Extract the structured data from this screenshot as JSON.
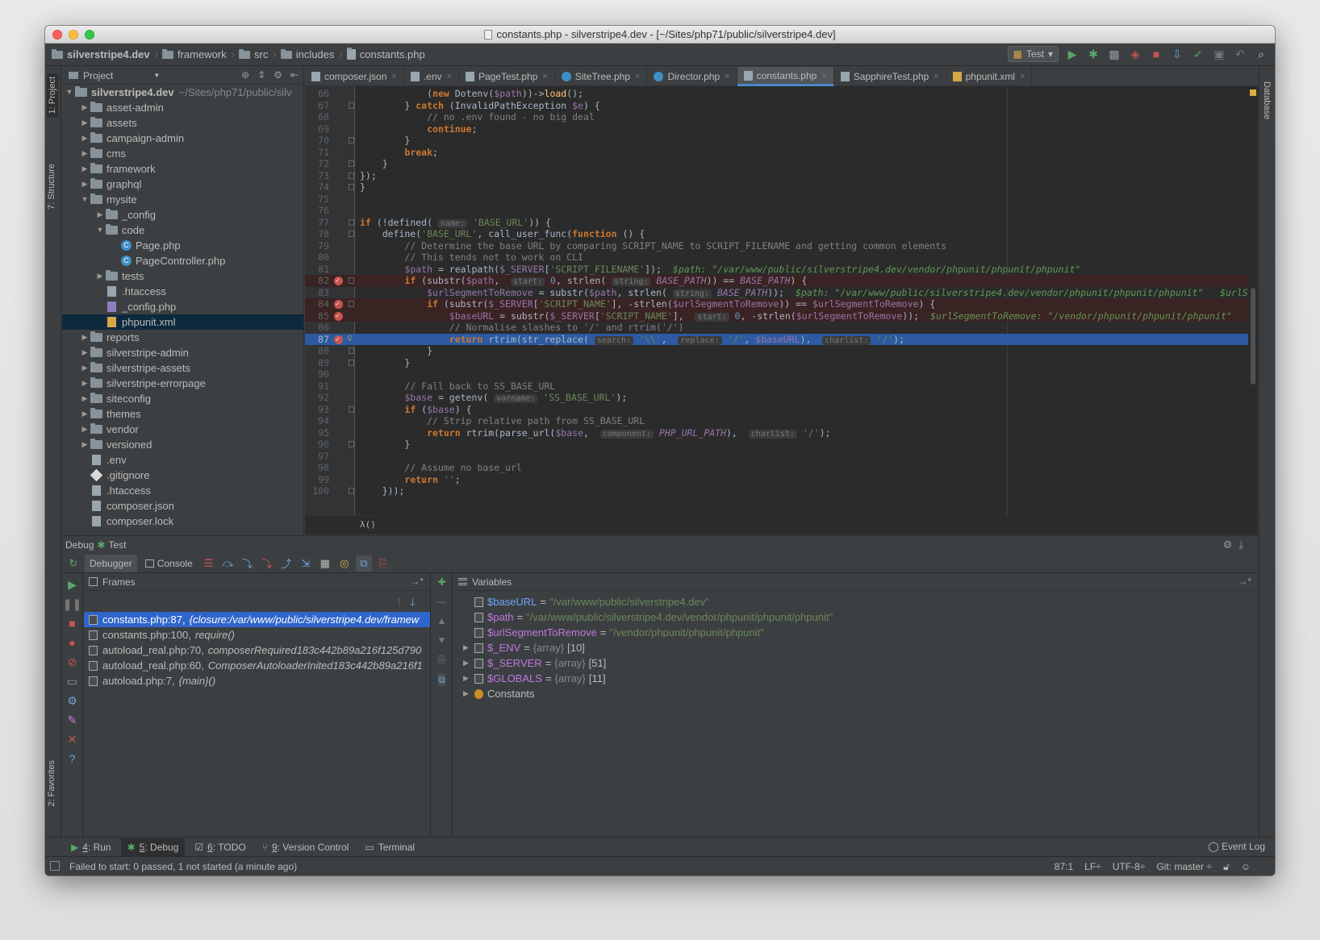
{
  "window": {
    "title": "constants.php - silverstripe4.dev - [~/Sites/php71/public/silverstripe4.dev]"
  },
  "breadcrumbs": [
    "silverstripe4.dev",
    "framework",
    "src",
    "includes",
    "constants.php"
  ],
  "run_config": {
    "name": "Test"
  },
  "left_strip": {
    "project_tab": "1: Project",
    "structure_tab": "7: Structure",
    "favorites_tab": "2: Favorites"
  },
  "right_strip": {
    "database_tab": "Database"
  },
  "project_panel": {
    "header": "Project",
    "root": {
      "name": "silverstripe4.dev",
      "path": "~/Sites/php71/public/silv"
    },
    "items": [
      {
        "label": "asset-admin",
        "kind": "folder",
        "indent": 1,
        "arrow": "▶"
      },
      {
        "label": "assets",
        "kind": "folder",
        "indent": 1,
        "arrow": "▶"
      },
      {
        "label": "campaign-admin",
        "kind": "folder",
        "indent": 1,
        "arrow": "▶"
      },
      {
        "label": "cms",
        "kind": "folder",
        "indent": 1,
        "arrow": "▶"
      },
      {
        "label": "framework",
        "kind": "folder",
        "indent": 1,
        "arrow": "▶"
      },
      {
        "label": "graphql",
        "kind": "folder",
        "indent": 1,
        "arrow": "▶"
      },
      {
        "label": "mysite",
        "kind": "folder",
        "indent": 1,
        "arrow": "▼"
      },
      {
        "label": "_config",
        "kind": "folder",
        "indent": 2,
        "arrow": "▶"
      },
      {
        "label": "code",
        "kind": "folder",
        "indent": 2,
        "arrow": "▼"
      },
      {
        "label": "Page.php",
        "kind": "class",
        "indent": 3,
        "arrow": ""
      },
      {
        "label": "PageController.php",
        "kind": "class",
        "indent": 3,
        "arrow": ""
      },
      {
        "label": "tests",
        "kind": "folder",
        "indent": 2,
        "arrow": "▶"
      },
      {
        "label": ".htaccess",
        "kind": "file",
        "indent": 2,
        "arrow": ""
      },
      {
        "label": "_config.php",
        "kind": "php",
        "indent": 2,
        "arrow": ""
      },
      {
        "label": "phpunit.xml",
        "kind": "xml",
        "indent": 2,
        "arrow": "",
        "selected": true
      },
      {
        "label": "reports",
        "kind": "folder",
        "indent": 1,
        "arrow": "▶"
      },
      {
        "label": "silverstripe-admin",
        "kind": "folder",
        "indent": 1,
        "arrow": "▶"
      },
      {
        "label": "silverstripe-assets",
        "kind": "folder",
        "indent": 1,
        "arrow": "▶"
      },
      {
        "label": "silverstripe-errorpage",
        "kind": "folder",
        "indent": 1,
        "arrow": "▶"
      },
      {
        "label": "siteconfig",
        "kind": "folder",
        "indent": 1,
        "arrow": "▶"
      },
      {
        "label": "themes",
        "kind": "folder",
        "indent": 1,
        "arrow": "▶"
      },
      {
        "label": "vendor",
        "kind": "folder",
        "indent": 1,
        "arrow": "▶"
      },
      {
        "label": "versioned",
        "kind": "folder",
        "indent": 1,
        "arrow": "▶"
      },
      {
        "label": ".env",
        "kind": "file",
        "indent": 1,
        "arrow": ""
      },
      {
        "label": ".gitignore",
        "kind": "git",
        "indent": 1,
        "arrow": ""
      },
      {
        "label": ".htaccess",
        "kind": "file",
        "indent": 1,
        "arrow": ""
      },
      {
        "label": "composer.json",
        "kind": "file",
        "indent": 1,
        "arrow": ""
      },
      {
        "label": "composer.lock",
        "kind": "file",
        "indent": 1,
        "arrow": ""
      }
    ]
  },
  "editor": {
    "tabs": [
      {
        "label": "composer.json",
        "icon": "file"
      },
      {
        "label": ".env",
        "icon": "file"
      },
      {
        "label": "PageTest.php",
        "icon": "file"
      },
      {
        "label": "SiteTree.php",
        "icon": "class"
      },
      {
        "label": "Director.php",
        "icon": "class"
      },
      {
        "label": "constants.php",
        "icon": "file",
        "active": true
      },
      {
        "label": "SapphireTest.php",
        "icon": "file"
      },
      {
        "label": "phpunit.xml",
        "icon": "xml"
      }
    ],
    "footer": "λ()",
    "lines": [
      {
        "n": "66",
        "html": "            (<span class=\"kw\">new</span> Dotenv(<span class=\"var\">$path</span>))-&gt;<span class=\"fn\">load</span>();"
      },
      {
        "n": "67",
        "html": "        } <span class=\"kw\">catch</span> (InvalidPathException <span class=\"var\">$e</span>) {"
      },
      {
        "n": "68",
        "html": "            <span class=\"cmt\">// no .env found - no big deal</span>"
      },
      {
        "n": "69",
        "html": "            <span class=\"kw\">continue</span>;"
      },
      {
        "n": "70",
        "html": "        }"
      },
      {
        "n": "71",
        "html": "        <span class=\"kw\">break</span>;"
      },
      {
        "n": "72",
        "html": "    }"
      },
      {
        "n": "73",
        "html": "});"
      },
      {
        "n": "74",
        "html": "}"
      },
      {
        "n": "75",
        "html": ""
      },
      {
        "n": "76",
        "html": ""
      },
      {
        "n": "77",
        "html": "<span class=\"kw\">if</span> (!defined( <span class=\"hint\">name:</span> <span class=\"str\">'BASE_URL'</span>)) {"
      },
      {
        "n": "78",
        "html": "    define(<span class=\"str\">'BASE_URL'</span>, call_user_func(<span class=\"kw\">function</span> () {"
      },
      {
        "n": "79",
        "html": "        <span class=\"cmt\">// Determine the base URL by comparing SCRIPT_NAME to SCRIPT_FILENAME and getting common elements</span>"
      },
      {
        "n": "80",
        "html": "        <span class=\"cmt\">// This tends not to work on CLI</span>"
      },
      {
        "n": "81",
        "html": "        <span class=\"var\">$path</span> = realpath(<span class=\"var\">$_SERVER</span>[<span class=\"str\">'SCRIPT_FILENAME'</span>]);<span class=\"inline-val\">$path: \"/var/www/public/silverstripe4.dev/vendor/phpunit/phpunit/phpunit\"</span>"
      },
      {
        "n": "82",
        "html": "        <span class=\"kw\">if</span> (substr(<span class=\"var\">$path</span>,  <span class=\"hint\">start:</span> <span class=\"num\">0</span>, strlen( <span class=\"hint\">string:</span> <span class=\"const\">BASE_PATH</span>)) == <span class=\"const\">BASE_PATH</span>) {",
        "bp": true
      },
      {
        "n": "83",
        "html": "            <span class=\"var\">$urlSegmentToRemove</span> = substr(<span class=\"var\">$path</span>, strlen( <span class=\"hint\">string:</span> <span class=\"const\">BASE_PATH</span>));<span class=\"inline-val\">$path: \"/var/www/public/silverstripe4.dev/vendor/phpunit/phpunit/phpunit\"   $urlSe</span>"
      },
      {
        "n": "84",
        "html": "            <span class=\"kw\">if</span> (substr(<span class=\"var\">$_SERVER</span>[<span class=\"str\">'SCRIPT_NAME'</span>], -strlen(<span class=\"var\">$urlSegmentToRemove</span>)) == <span class=\"var\">$urlSegmentToRemove</span>) {",
        "bp": true
      },
      {
        "n": "85",
        "html": "                <span class=\"var\">$baseURL</span> = substr(<span class=\"var\">$_SERVER</span>[<span class=\"str\">'SCRIPT_NAME'</span>],  <span class=\"hint\">start:</span> <span class=\"num\">0</span>, -strlen(<span class=\"var\">$urlSegmentToRemove</span>));<span class=\"inline-val\">$urlSegmentToRemove: \"/vendor/phpunit/phpunit/phpunit\"   $b</span>",
        "bp": true
      },
      {
        "n": "86",
        "html": "                <span class=\"cmt\">// Normalise slashes to '/' and rtrim('/')</span>"
      },
      {
        "n": "87",
        "html": "                <span class=\"kw\">return</span> rtrim(str_replace( <span class=\"hint\">search:</span> <span class=\"str\">'\\\\'</span>,  <span class=\"hint\">replace:</span> <span class=\"str\">'/'</span>, <span class=\"var\">$baseURL</span>),  <span class=\"hint\">charlist:</span> <span class=\"str\">'/'</span>);",
        "bp": true,
        "exec": true
      },
      {
        "n": "88",
        "html": "            }"
      },
      {
        "n": "89",
        "html": "        }"
      },
      {
        "n": "90",
        "html": ""
      },
      {
        "n": "91",
        "html": "        <span class=\"cmt\">// Fall back to SS_BASE_URL</span>"
      },
      {
        "n": "92",
        "html": "        <span class=\"var\">$base</span> = getenv( <span class=\"hint\">varname:</span> <span class=\"str\">'SS_BASE_URL'</span>);"
      },
      {
        "n": "93",
        "html": "        <span class=\"kw\">if</span> (<span class=\"var\">$base</span>) {"
      },
      {
        "n": "94",
        "html": "            <span class=\"cmt\">// Strip relative path from SS_BASE_URL</span>"
      },
      {
        "n": "95",
        "html": "            <span class=\"kw\">return</span> rtrim(parse_url(<span class=\"var\">$base</span>,  <span class=\"hint\">component:</span> <span class=\"const\">PHP_URL_PATH</span>),  <span class=\"hint\">charlist:</span> <span class=\"str\">'/'</span>);"
      },
      {
        "n": "96",
        "html": "        }"
      },
      {
        "n": "97",
        "html": ""
      },
      {
        "n": "98",
        "html": "        <span class=\"cmt\">// Assume no base_url</span>"
      },
      {
        "n": "99",
        "html": "        <span class=\"kw\">return</span> <span class=\"str\">''</span>;"
      },
      {
        "n": "100",
        "html": "    }));"
      }
    ]
  },
  "debug": {
    "title": "Debug",
    "config": "Test",
    "tabs": {
      "debugger": "Debugger",
      "console": "Console"
    },
    "frames": {
      "header": "Frames",
      "items": [
        {
          "loc": "constants.php:87,",
          "extra": "{closure:/var/www/public/silverstripe4.dev/framew",
          "selected": true
        },
        {
          "loc": "constants.php:100,",
          "extra": "require()"
        },
        {
          "loc": "autoload_real.php:70,",
          "extra": "composerRequired183c442b89a216f125d790"
        },
        {
          "loc": "autoload_real.php:60,",
          "extra": "ComposerAutoloaderInited183c442b89a216f1"
        },
        {
          "loc": "autoload.php:7,",
          "extra": "{main}()"
        }
      ]
    },
    "variables": {
      "header": "Variables",
      "items": [
        {
          "name": "$baseURL",
          "eq": "=",
          "value": "\"/var/www/public/silverstripe4.dev\"",
          "type": "",
          "count": "",
          "expandable": false
        },
        {
          "name": "$path",
          "eq": "=",
          "value": "\"/var/www/public/silverstripe4.dev/vendor/phpunit/phpunit/phpunit\"",
          "type": "",
          "count": "",
          "expandable": false
        },
        {
          "name": "$urlSegmentToRemove",
          "eq": "=",
          "value": "\"/vendor/phpunit/phpunit/phpunit\"",
          "type": "",
          "count": "",
          "expandable": false
        },
        {
          "name": "$_ENV",
          "eq": "=",
          "value": "",
          "type": "{array}",
          "count": "[10]",
          "expandable": true
        },
        {
          "name": "$_SERVER",
          "eq": "=",
          "value": "",
          "type": "{array}",
          "count": "[51]",
          "expandable": true
        },
        {
          "name": "$GLOBALS",
          "eq": "=",
          "value": "",
          "type": "{array}",
          "count": "[11]",
          "expandable": true
        },
        {
          "name": "Constants",
          "eq": "",
          "value": "",
          "type": "",
          "count": "",
          "expandable": true,
          "plain": true
        }
      ]
    }
  },
  "toolwindows": [
    {
      "num": "4",
      "label": ": Run",
      "icon": "▶",
      "color": "#59a869"
    },
    {
      "num": "5",
      "label": ": Debug",
      "icon": "✱",
      "color": "#59a869",
      "active": true
    },
    {
      "num": "6",
      "label": ": TODO",
      "icon": "☑",
      "color": "#bbbbbb"
    },
    {
      "num": "9",
      "label": ": Version Control",
      "icon": "⑂",
      "color": "#6ea4d8"
    },
    {
      "num": "",
      "label": "Terminal",
      "icon": "▭",
      "color": "#bbbbbb"
    }
  ],
  "event_log": "Event Log",
  "status": {
    "message": "Failed to start: 0 passed, 1 not started (a minute ago)",
    "position": "87:1",
    "line_sep": "LF÷",
    "encoding": "UTF-8÷",
    "git": "Git: master ÷"
  },
  "colors": {
    "accent": "#2f65ca",
    "exec_line": "#2d5aa0",
    "breakpoint": "#c75450"
  }
}
